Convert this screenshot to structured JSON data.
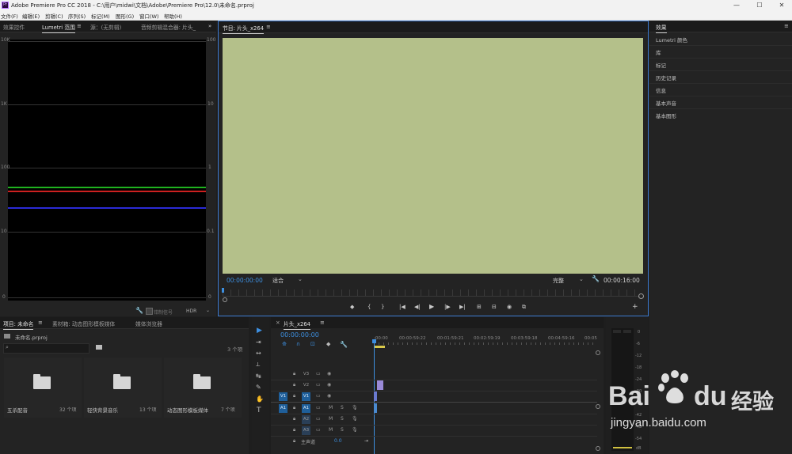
{
  "app": {
    "title": "Adobe Premiere Pro CC 2018 - C:\\用户\\midwi\\文档\\Adobe\\Premiere Pro\\12.0\\未命名.prproj",
    "logo_text": "Pr",
    "minimize": "—",
    "maximize": "☐",
    "close": "✕"
  },
  "menu": [
    "文件(F)",
    "编辑(E)",
    "剪辑(C)",
    "序列(S)",
    "标记(M)",
    "图形(G)",
    "窗口(W)",
    "帮助(H)"
  ],
  "source_panel": {
    "tabs": [
      "效果控件",
      "Lumetri 范围",
      "源：(无剪辑)",
      "音频剪辑混合器: 片头_"
    ],
    "tab_menu": "≡",
    "overflow": "»",
    "scale_left": [
      "10K",
      "1K",
      "100",
      "10",
      "0"
    ],
    "scale_right": [
      "100",
      "10",
      "1",
      "0.1",
      "0"
    ],
    "clamp_label": "钳制信号",
    "hdr_label": "HDR",
    "wrench": "🔧"
  },
  "program_panel": {
    "title": "节目: 片头_x264",
    "menu": "≡",
    "timecode_in": "00:00:00:00",
    "fit": "适合",
    "quality": "完整",
    "timecode_out": "00:00:16:00",
    "video_color": "#b4c08a",
    "controls": [
      "◆",
      "{",
      "}",
      "|◀",
      "◀|",
      "▶",
      "|▶",
      "▶|",
      "⊞",
      "⊟",
      "◉",
      "⧉"
    ],
    "plus": "+"
  },
  "effects_panel": {
    "title": "效果",
    "menu": "≡",
    "items": [
      "Lumetri 颜色",
      "库",
      "标记",
      "历史记录",
      "信息",
      "基本声音",
      "基本图形"
    ]
  },
  "project_panel": {
    "tabs": [
      "项目: 未命名",
      "素材箱: 动态图形模板媒体",
      "媒体浏览器"
    ],
    "menu": "≡",
    "file": "未命名.prproj",
    "count": "3 个项",
    "search_placeholder": "",
    "bins": [
      {
        "name": "五杀配音",
        "count": "32 个项"
      },
      {
        "name": "轻快背景音乐",
        "count": "13 个项"
      },
      {
        "name": "动态图形模板媒体",
        "count": "7 个项"
      }
    ]
  },
  "timeline": {
    "title": "片头_x264",
    "close": "×",
    "menu": "≡",
    "timecode": "00:00:00:00",
    "ruler": [
      ":00:00",
      "00:00:59:22",
      "00:01:59:21",
      "00:02:59:19",
      "00:03:59:18",
      "00:04:59:16",
      "00:05"
    ],
    "tracks": [
      {
        "src": "",
        "name": "V3"
      },
      {
        "src": "",
        "name": "V2"
      },
      {
        "src": "V1",
        "name": "V1"
      },
      {
        "src": "A1",
        "name": "A1"
      },
      {
        "src": "",
        "name": "A2"
      },
      {
        "src": "",
        "name": "A3"
      }
    ],
    "master_label": "主声道",
    "master_value": "0.0",
    "m": "M",
    "s": "S"
  },
  "tools": [
    "▶",
    "⇥",
    "↔",
    "⟂",
    "↹",
    "✎",
    "✋",
    "T"
  ],
  "meter": {
    "scale": [
      "0",
      "-6",
      "-12",
      "-18",
      "-24",
      "-30",
      "-36",
      "-42",
      "-48",
      "-54",
      "dB"
    ]
  },
  "watermark": {
    "text1": "Bai",
    "text2": "du",
    "text3": "经验",
    "url": "jingyan.baidu.com"
  }
}
